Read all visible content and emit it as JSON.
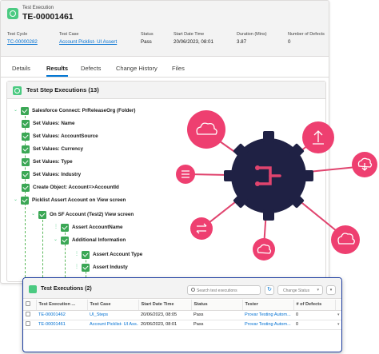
{
  "record": {
    "object_label": "Test Execution",
    "name": "TE-00001461",
    "fields": [
      {
        "label": "Test Cycle",
        "value": "TC-00000282",
        "link": true
      },
      {
        "label": "Test Case",
        "value": "Account Picklist- UI Assert",
        "link": true
      },
      {
        "label": "Status",
        "value": "Pass",
        "link": false
      },
      {
        "label": "Start Date Time",
        "value": "20/06/2023, 08:01",
        "link": false
      },
      {
        "label": "Duration (Mins)",
        "value": "3.87",
        "link": false
      },
      {
        "label": "Number of Defects",
        "value": "0",
        "link": false
      }
    ]
  },
  "tabs": [
    "Details",
    "Results",
    "Defects",
    "Change History",
    "Files"
  ],
  "active_tab": "Results",
  "steps_panel": {
    "title": "Test Step Executions (13)",
    "steps": [
      {
        "label": "Salesforce Connect: PrReleaseOrg (Folder)",
        "depth": 0
      },
      {
        "label": "Set Values: Name",
        "depth": 0
      },
      {
        "label": "Set Values: AccountSource",
        "depth": 0
      },
      {
        "label": "Set Values: Currency",
        "depth": 0
      },
      {
        "label": "Set Values: Type",
        "depth": 0
      },
      {
        "label": "Set Values: Industry",
        "depth": 0
      },
      {
        "label": "Create Object: Account=>AccountId",
        "depth": 0
      },
      {
        "label": "Picklist Assert Account on View screen",
        "depth": 0
      },
      {
        "label": "On SF Account (Test2) View screen",
        "depth": 1
      },
      {
        "label": "Assert AccountName",
        "depth": 2
      },
      {
        "label": "Additional Information",
        "depth": 2
      },
      {
        "label": "Assert Account Type",
        "depth": 3
      },
      {
        "label": "Assert Industy",
        "depth": 3
      }
    ]
  },
  "executions": {
    "title": "Test Executions (2)",
    "search_placeholder": "Search test executions",
    "status_placeholder": "Change Status",
    "columns": [
      "Test Execution ...",
      "Test Case",
      "Start Date Time",
      "Status",
      "Tester",
      "# of Defects"
    ],
    "rows": [
      [
        "TE-00001462",
        "UI_Steps",
        "20/06/2023, 08:05",
        "Pass",
        "Provar Testing Autom...",
        "0"
      ],
      [
        "TE-00001461",
        "Account Picklist- UI Ass...",
        "20/06/2023, 08:01",
        "Pass",
        "Provar Testing Autom...",
        "0"
      ]
    ]
  },
  "colors": {
    "accent": "#0176d3",
    "success": "#3ba755",
    "hub": "#1f2144",
    "node": "#ee3f70",
    "link_line": "#e0446e"
  }
}
